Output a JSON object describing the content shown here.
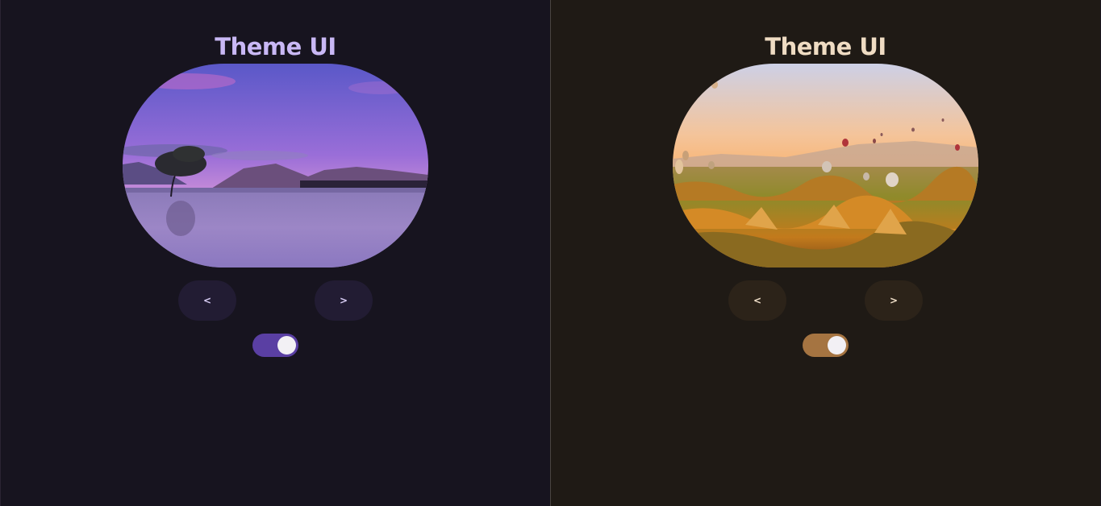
{
  "panels": [
    {
      "theme": "purple",
      "title": "Theme UI",
      "prev_label": "<",
      "next_label": ">",
      "toggle_on": true,
      "accent": "#5a3fa3",
      "image": "lake-tree-sunset"
    },
    {
      "theme": "amber",
      "title": "Theme UI",
      "prev_label": "<",
      "next_label": ">",
      "toggle_on": true,
      "accent": "#a57441",
      "image": "hot-air-balloons-valley"
    }
  ]
}
